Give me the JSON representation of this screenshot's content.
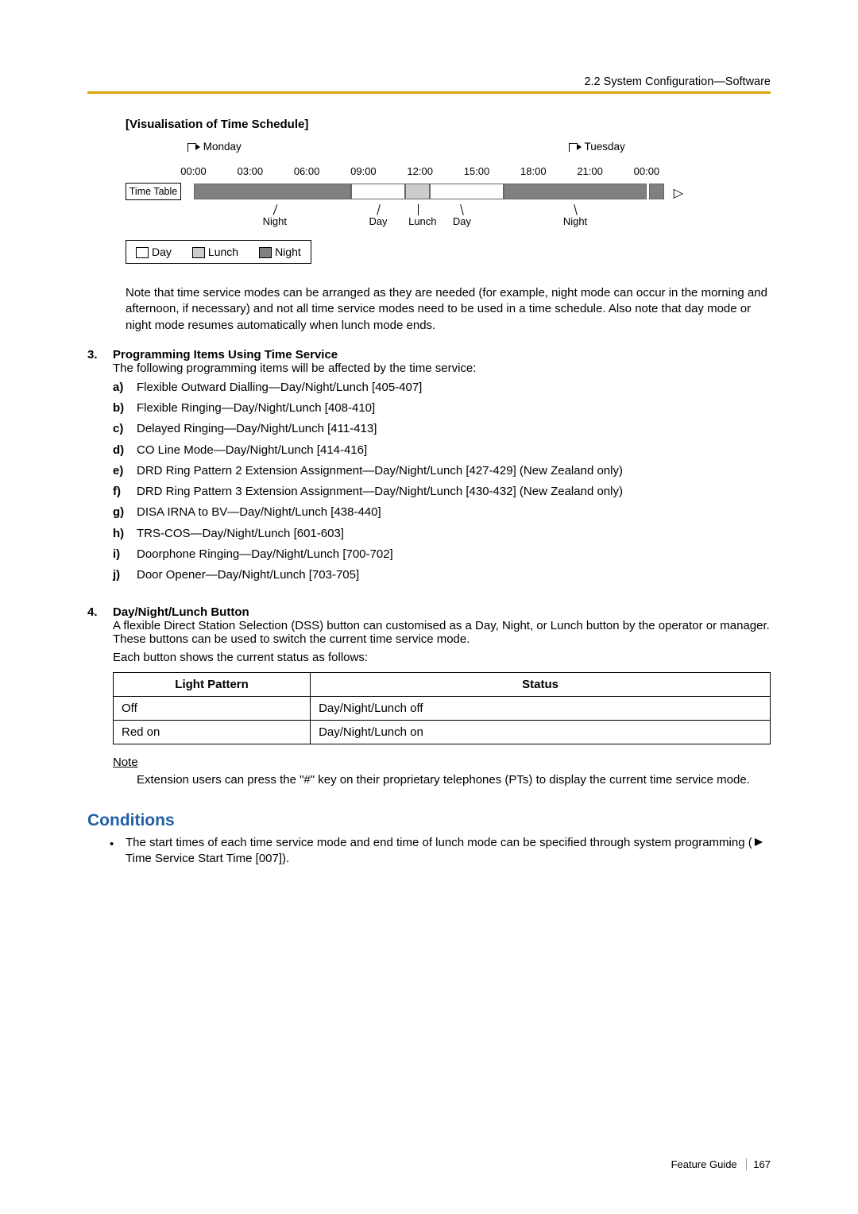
{
  "header": "2.2 System Configuration—Software",
  "vis_title": "[Visualisation of Time Schedule]",
  "days": {
    "monday": "Monday",
    "tuesday": "Tuesday"
  },
  "ticks": [
    "00:00",
    "03:00",
    "06:00",
    "09:00",
    "12:00",
    "15:00",
    "18:00",
    "21:00",
    "00:00"
  ],
  "time_table_label": "Time Table",
  "seg_labels": {
    "night1": "Night",
    "day1": "Day",
    "lunch": "Lunch",
    "day2": "Day",
    "night2": "Night"
  },
  "legend": {
    "day": "Day",
    "lunch": "Lunch",
    "night": "Night"
  },
  "note_para": "Note that time service modes can be arranged as they are needed (for example, night mode can occur in the morning and afternoon, if necessary) and not all time service modes need to be used in a time schedule. Also note that day mode or night mode resumes automatically when lunch mode ends.",
  "item3": {
    "num": "3.",
    "title": "Programming Items Using Time Service",
    "intro": "The following programming items will be affected by the time service:",
    "subs": [
      {
        "m": "a)",
        "t": "Flexible Outward Dialling—Day/Night/Lunch [405-407]"
      },
      {
        "m": "b)",
        "t": "Flexible Ringing—Day/Night/Lunch [408-410]"
      },
      {
        "m": "c)",
        "t": "Delayed Ringing—Day/Night/Lunch [411-413]"
      },
      {
        "m": "d)",
        "t": "CO Line Mode—Day/Night/Lunch [414-416]"
      },
      {
        "m": "e)",
        "t": "DRD Ring Pattern 2 Extension Assignment—Day/Night/Lunch [427-429] (New Zealand only)"
      },
      {
        "m": "f)",
        "t": "DRD Ring Pattern 3 Extension Assignment—Day/Night/Lunch [430-432] (New Zealand only)"
      },
      {
        "m": "g)",
        "t": "DISA IRNA to BV—Day/Night/Lunch [438-440]"
      },
      {
        "m": "h)",
        "t": "TRS-COS—Day/Night/Lunch [601-603]"
      },
      {
        "m": "i)",
        "t": "Doorphone Ringing—Day/Night/Lunch [700-702]"
      },
      {
        "m": "j)",
        "t": "Door Opener—Day/Night/Lunch [703-705]"
      }
    ]
  },
  "item4": {
    "num": "4.",
    "title": "Day/Night/Lunch Button",
    "p1": "A flexible Direct Station Selection (DSS) button can customised as a Day, Night, or Lunch button by the operator or manager.",
    "p2": "These buttons can be used to switch the current time service mode.",
    "p3": "Each button shows the current status as follows:"
  },
  "table": {
    "h1": "Light Pattern",
    "h2": "Status",
    "rows": [
      {
        "c1": "Off",
        "c2": "Day/Night/Lunch off"
      },
      {
        "c1": "Red on",
        "c2": "Day/Night/Lunch on"
      }
    ]
  },
  "note": {
    "label": "Note",
    "body": "Extension users can press the \"#\" key on their proprietary telephones (PTs) to display the current time service mode."
  },
  "conditions": {
    "heading": "Conditions",
    "bullet_pre": "The start times of each time service mode and end time of lunch mode can be specified through system programming (",
    "bullet_post": " Time Service Start Time [007])."
  },
  "footer": {
    "guide": "Feature Guide",
    "page": "167"
  }
}
